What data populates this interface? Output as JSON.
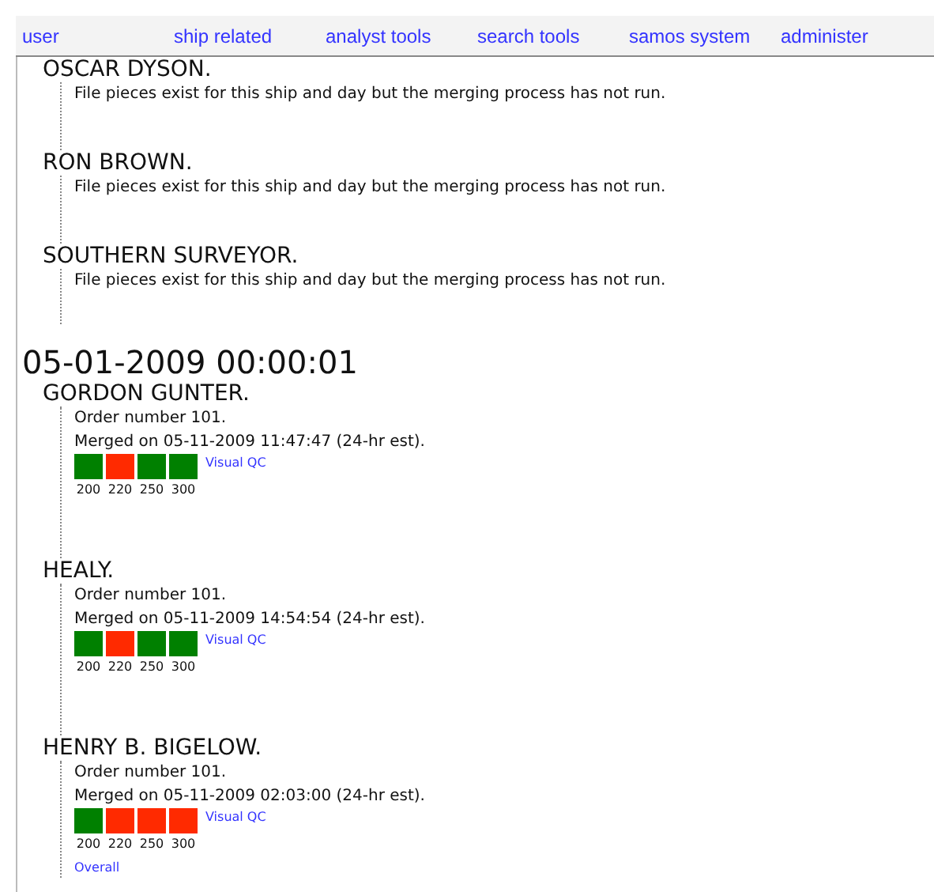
{
  "nav": [
    {
      "label": "user"
    },
    {
      "label": "ship related"
    },
    {
      "label": "analyst tools"
    },
    {
      "label": "search tools"
    },
    {
      "label": "samos system"
    },
    {
      "label": "administer"
    }
  ],
  "groups": [
    {
      "ships": [
        {
          "name": "OSCAR DYSON.",
          "lines": [
            "File pieces exist for this ship and day but the merging process has not run."
          ]
        },
        {
          "name": "RON BROWN.",
          "lines": [
            "File pieces exist for this ship and day but the merging process has not run."
          ]
        },
        {
          "name": "SOUTHERN SURVEYOR.",
          "lines": [
            "File pieces exist for this ship and day but the merging process has not run."
          ]
        }
      ]
    },
    {
      "date": "05-01-2009 00:00:01",
      "ships": [
        {
          "name": "GORDON GUNTER.",
          "lines": [
            "Order number 101.",
            "Merged on 05-11-2009 11:47:47 (24-hr est)."
          ],
          "qc_link": "Visual QC",
          "qc": [
            {
              "label": "200",
              "color": "#008000"
            },
            {
              "label": "220",
              "color": "#ff2a00"
            },
            {
              "label": "250",
              "color": "#008000"
            },
            {
              "label": "300",
              "color": "#008000"
            }
          ]
        },
        {
          "name": "HEALY.",
          "lines": [
            "Order number 101.",
            "Merged on 05-11-2009 14:54:54 (24-hr est)."
          ],
          "qc_link": "Visual QC",
          "qc": [
            {
              "label": "200",
              "color": "#008000"
            },
            {
              "label": "220",
              "color": "#ff2a00"
            },
            {
              "label": "250",
              "color": "#008000"
            },
            {
              "label": "300",
              "color": "#008000"
            }
          ]
        },
        {
          "name": "HENRY B. BIGELOW.",
          "lines": [
            "Order number 101.",
            "Merged on 05-11-2009 02:03:00 (24-hr est)."
          ],
          "qc_link": "Visual QC",
          "qc": [
            {
              "label": "200",
              "color": "#008000"
            },
            {
              "label": "220",
              "color": "#ff2a00"
            },
            {
              "label": "250",
              "color": "#ff2a00"
            },
            {
              "label": "300",
              "color": "#ff2a00"
            }
          ],
          "overall": "Overall"
        }
      ]
    }
  ]
}
